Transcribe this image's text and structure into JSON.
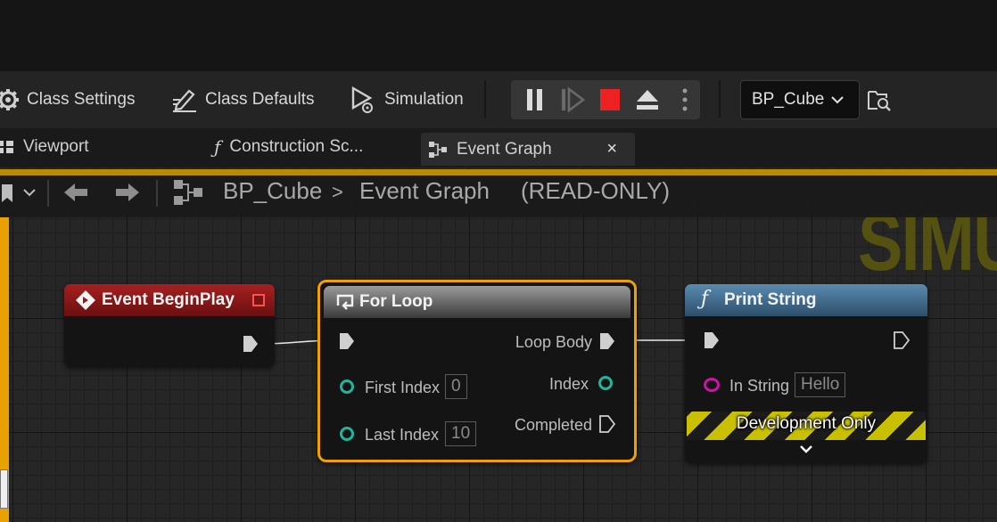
{
  "toolbar": {
    "class_settings": "Class Settings",
    "class_defaults": "Class Defaults",
    "simulation": "Simulation",
    "blueprint_selector": "BP_Cube"
  },
  "tabs": [
    {
      "label": "Viewport"
    },
    {
      "label": "Construction Sc..."
    },
    {
      "label": "Event Graph",
      "close": "×"
    }
  ],
  "breadcrumb": {
    "blueprint": "BP_Cube",
    "separator": ">",
    "graph": "Event Graph",
    "mode": "(READ-ONLY)"
  },
  "watermark": "SIMU",
  "nodes": {
    "begin_play": {
      "title": "Event BeginPlay",
      "color": "#8c1a1a"
    },
    "for_loop": {
      "title": "For Loop",
      "first_index_label": "First Index",
      "first_index_value": "0",
      "last_index_label": "Last Index",
      "last_index_value": "10",
      "loop_body_label": "Loop Body",
      "index_label": "Index",
      "completed_label": "Completed",
      "highlight": "#f0a000"
    },
    "print_string": {
      "title": "Print String",
      "in_string_label": "In String",
      "in_string_value": "Hello",
      "dev_only": "Development Only",
      "color": "#3f6c8f"
    }
  },
  "colors": {
    "accent": "#b88a08",
    "int_pin": "#1fb69a",
    "string_pin": "#d011a8",
    "stop_button": "#ee2222"
  }
}
